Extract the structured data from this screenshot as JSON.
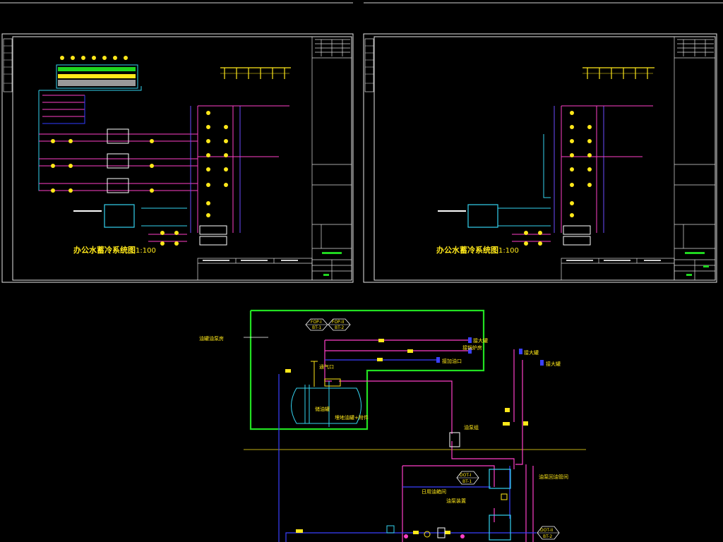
{
  "sheet_left": {
    "title": "办公水蓄冷系统图",
    "scale": "1:100"
  },
  "sheet_right": {
    "title": "办公水蓄冷系统图",
    "scale": "1:100"
  },
  "bottom_diagram": {
    "callout_left": "油罐油泵房",
    "tag_1_top": "FOP-I",
    "tag_1_bottom": "BT-1",
    "tag_2_top": "FOP-II",
    "tag_2_bottom": "BT-2",
    "right_label_1": "接大罐",
    "right_label_2": "接锅炉房",
    "right_label_3": "接加油口",
    "label_vent": "通气口",
    "label_tank": "储油罐",
    "label_tank_sub": "埋地油罐+附件",
    "label_pump_group": "油泵组",
    "label_top_1": "接大罐",
    "label_top_2": "接大罐",
    "label_mid": "日用油箱间",
    "label_equip": "油泵装置",
    "label_right_mid": "油泵回油管间",
    "tag_3_top": "DOT-I",
    "tag_3_bottom": "BT-1",
    "tag_4_top": "DOT-II",
    "tag_4_bottom": "BT-2"
  }
}
